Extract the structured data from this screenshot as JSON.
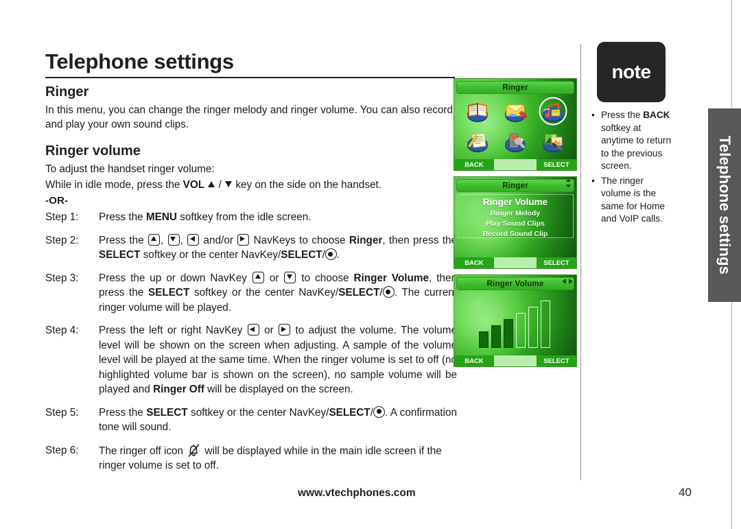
{
  "page": {
    "chapter_title": "Telephone settings",
    "side_tab_label": "Telephone settings",
    "footer_site": "www.vtechphones.com",
    "footer_page_number": "40"
  },
  "sections": {
    "ringer_heading": "Ringer",
    "ringer_intro": "In this menu, you can change the ringer melody and ringer volume. You can also record and play your own sound clips.",
    "ringer_volume_heading": "Ringer volume",
    "ringer_volume_intro": "To adjust the handset ringer volume:",
    "idle_mode_line_a": "While in idle mode, press the ",
    "idle_mode_vol": "VOL",
    "idle_mode_line_b": " key on the side on the handset.",
    "or_divider": "-OR-"
  },
  "steps": [
    {
      "label": "Step 1:",
      "parts": [
        {
          "t": "Press the "
        },
        {
          "t": "MENU",
          "b": true
        },
        {
          "t": " softkey from the idle screen."
        }
      ]
    },
    {
      "label": "Step 2:",
      "parts": [
        {
          "t": "Press the "
        },
        {
          "icon": "navkey-up"
        },
        {
          "t": ", "
        },
        {
          "icon": "navkey-down"
        },
        {
          "t": ", "
        },
        {
          "icon": "navkey-left"
        },
        {
          "t": " and/or "
        },
        {
          "icon": "navkey-right"
        },
        {
          "t": " NavKeys to choose "
        },
        {
          "t": "Ringer",
          "b": true
        },
        {
          "t": ", then press the "
        },
        {
          "t": "SELECT",
          "b": true
        },
        {
          "t": " softkey or the center NavKey/"
        },
        {
          "t": "SELECT",
          "b": true
        },
        {
          "t": "/"
        },
        {
          "icon": "select-key"
        },
        {
          "t": "."
        }
      ]
    },
    {
      "label": "Step 3:",
      "parts": [
        {
          "t": "Press the up or down NavKey "
        },
        {
          "icon": "navkey-up"
        },
        {
          "t": " or "
        },
        {
          "icon": "navkey-down"
        },
        {
          "t": " to choose "
        },
        {
          "t": "Ringer Volume",
          "b": true
        },
        {
          "t": ", then press the "
        },
        {
          "t": "SELECT",
          "b": true
        },
        {
          "t": " softkey or the center NavKey/"
        },
        {
          "t": "SELECT",
          "b": true
        },
        {
          "t": "/"
        },
        {
          "icon": "select-key"
        },
        {
          "t": ". The current ringer volume will be played."
        }
      ]
    },
    {
      "label": "Step 4:",
      "parts": [
        {
          "t": "Press the left or right NavKey "
        },
        {
          "icon": "navkey-left"
        },
        {
          "t": " or "
        },
        {
          "icon": "navkey-right"
        },
        {
          "t": " to adjust the volume. The volume level will be shown on the screen when adjusting. A sample of the volume level will be played at the same time. When the ringer volume is set to off (no highlighted volume bar is shown on the screen), no sample volume will be played and "
        },
        {
          "t": "Ringer Off",
          "b": true
        },
        {
          "t": " will be displayed on the screen."
        }
      ]
    },
    {
      "label": "Step 5:",
      "parts": [
        {
          "t": "Press the "
        },
        {
          "t": "SELECT",
          "b": true
        },
        {
          "t": " softkey or the center NavKey/"
        },
        {
          "t": "SELECT",
          "b": true
        },
        {
          "t": "/"
        },
        {
          "icon": "select-key"
        },
        {
          "t": ". A confirmation tone will sound."
        }
      ]
    },
    {
      "label": "Step 6:",
      "parts": [
        {
          "t": "The ringer off icon "
        },
        {
          "icon": "bell-off"
        },
        {
          "t": " will be displayed while in the main idle screen if the ringer volume is set to off."
        }
      ]
    }
  ],
  "note": {
    "badge_label": "note",
    "items": [
      [
        {
          "t": "Press the "
        },
        {
          "t": "BACK",
          "b": true
        },
        {
          "t": " softkey at anytime to return to the previous screen."
        }
      ],
      [
        {
          "t": "The ringer volume is the same for Home and VoIP calls."
        }
      ]
    ]
  },
  "screens": [
    {
      "name": "main-menu-screen",
      "title": "Ringer",
      "type": "icon-grid",
      "scroll_indicator": "none",
      "icons": [
        {
          "name": "phonebook-icon",
          "selected": false
        },
        {
          "name": "messages-icon",
          "selected": false
        },
        {
          "name": "ringer-icon",
          "selected": true
        },
        {
          "name": "notepad-icon",
          "selected": false
        },
        {
          "name": "settings-icon",
          "selected": false
        },
        {
          "name": "pictures-icon",
          "selected": false
        }
      ],
      "softkeys": {
        "left": "BACK",
        "right": "SELECT"
      }
    },
    {
      "name": "ringer-menu-screen",
      "title": "Ringer",
      "type": "list",
      "scroll_indicator": "up-down",
      "items": [
        {
          "label": "Ringer Volume",
          "selected": true
        },
        {
          "label": "Ringer Melody",
          "selected": false
        },
        {
          "label": "Play Sound Clips",
          "selected": false
        },
        {
          "label": "Record Sound Clip",
          "selected": false
        }
      ],
      "softkeys": {
        "left": "BACK",
        "right": "SELECT"
      }
    },
    {
      "name": "ringer-volume-screen",
      "title": "Ringer Volume",
      "type": "volume-bars",
      "scroll_indicator": "left-right",
      "bars_total": 6,
      "bars_filled": 3,
      "softkeys": {
        "left": "BACK",
        "right": "SELECT"
      }
    }
  ],
  "colors": {
    "screen_green": "#35ad24",
    "screen_dark_green": "#0e4f0b",
    "softkey_green": "#23a517",
    "note_badge": "#262626",
    "side_tab_gray": "#58585a",
    "text": "#231f20"
  }
}
